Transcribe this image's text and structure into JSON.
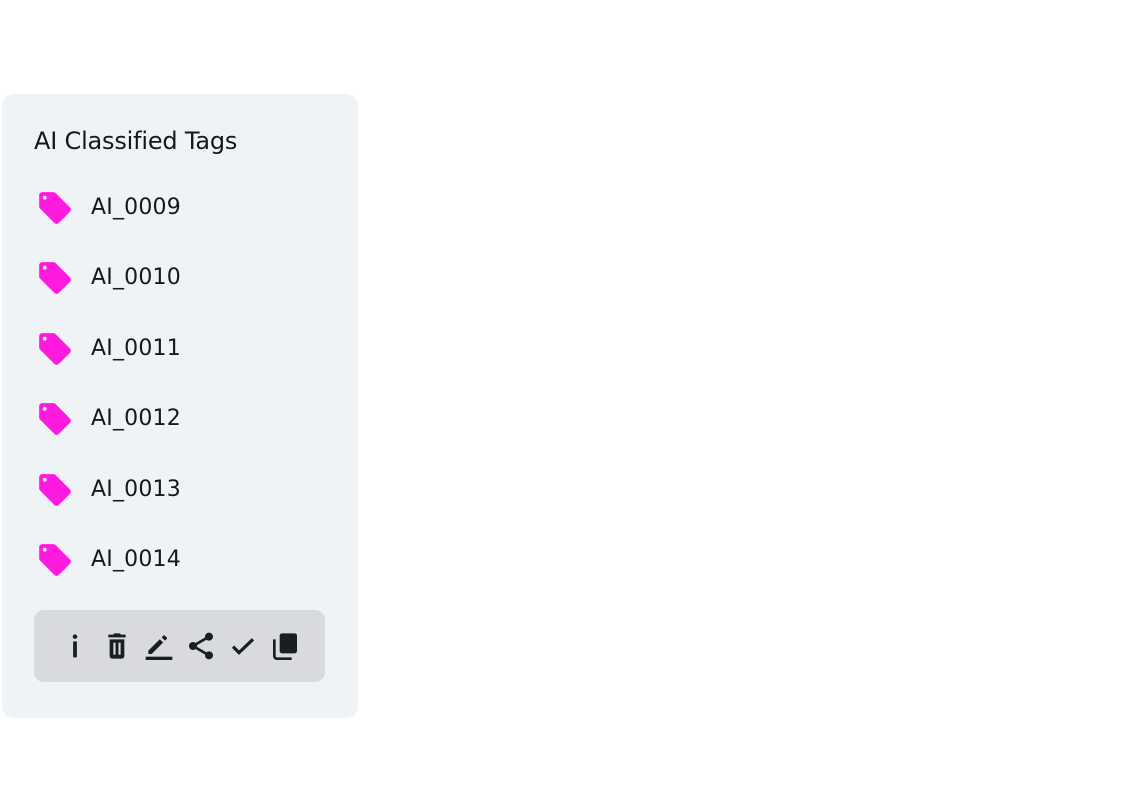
{
  "panel": {
    "title": "AI Classified Tags",
    "tags": [
      {
        "label": "AI_0009",
        "icon": "tag-icon"
      },
      {
        "label": "AI_0010",
        "icon": "tag-icon"
      },
      {
        "label": "AI_0011",
        "icon": "tag-icon"
      },
      {
        "label": "AI_0012",
        "icon": "tag-icon"
      },
      {
        "label": "AI_0013",
        "icon": "tag-icon"
      },
      {
        "label": "AI_0014",
        "icon": "tag-icon"
      }
    ],
    "tag_color": "#ff1ae0"
  },
  "toolbar": {
    "buttons": [
      {
        "icon": "info-icon"
      },
      {
        "icon": "delete-icon"
      },
      {
        "icon": "edit-icon"
      },
      {
        "icon": "share-icon"
      },
      {
        "icon": "check-icon"
      },
      {
        "icon": "copy-icon"
      }
    ],
    "background": "#d8dadd"
  },
  "colors": {
    "panel_background": "#f0f3f6",
    "text": "#14191f"
  }
}
